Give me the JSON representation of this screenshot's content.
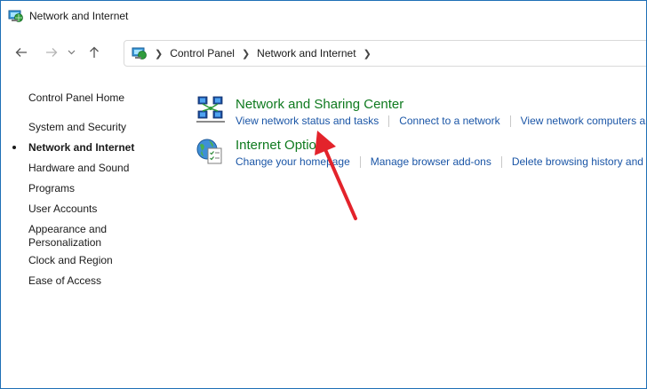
{
  "window": {
    "title": "Network and Internet"
  },
  "nav": {
    "back_icon": "back-arrow-icon",
    "forward_icon": "forward-arrow-icon",
    "recent_icon": "chevron-down-icon",
    "up_icon": "up-arrow-icon"
  },
  "address": {
    "crumbs": [
      "Control Panel",
      "Network and Internet"
    ]
  },
  "sidebar": {
    "home": "Control Panel Home",
    "items": [
      {
        "label": "System and Security"
      },
      {
        "label": "Network and Internet"
      },
      {
        "label": "Hardware and Sound"
      },
      {
        "label": "Programs"
      },
      {
        "label": "User Accounts"
      },
      {
        "label": "Appearance and\nPersonalization"
      },
      {
        "label": "Clock and Region"
      },
      {
        "label": "Ease of Access"
      }
    ]
  },
  "categories": [
    {
      "title": "Network and Sharing Center",
      "icon": "network-sharing-icon",
      "tasks": [
        "View network status and tasks",
        "Connect to a network",
        "View network computers and devices"
      ]
    },
    {
      "title": "Internet Options",
      "icon": "internet-options-icon",
      "tasks": [
        "Change your homepage",
        "Manage browser add-ons",
        "Delete browsing history and cookies"
      ]
    }
  ],
  "colors": {
    "category_title": "#0f7a1f",
    "task_link": "#1a55a6",
    "annotation_arrow": "#e3232b",
    "window_border": "#1f6fb6"
  }
}
